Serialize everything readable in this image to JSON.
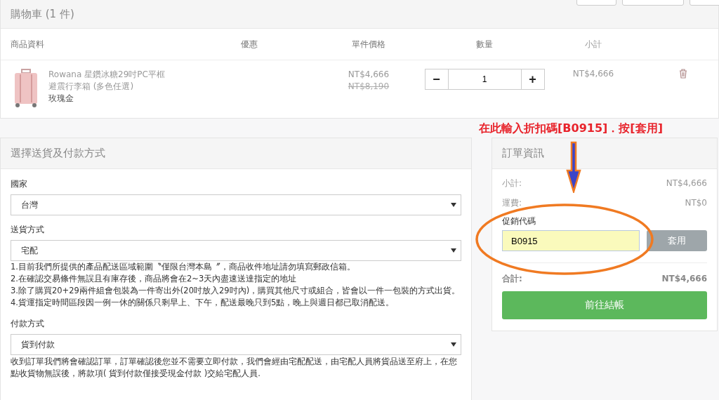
{
  "cart": {
    "title": "購物車 (1 件)",
    "columns": [
      "商品資料",
      "優惠",
      "單件價格",
      "數量",
      "小計"
    ],
    "items": [
      {
        "name": "Rowana 星鑽冰糖29吋PC平框避震行李箱 (多色任選)",
        "variant": "玫瑰金",
        "price": "NT$4,666",
        "original_price": "NT$8,190",
        "minus": "−",
        "quantity": "1",
        "plus": "+",
        "subtotal": "NT$4,666"
      }
    ]
  },
  "shipping": {
    "title": "選擇送貨及付款方式",
    "fields": [
      {
        "label": "國家",
        "value": "台灣"
      },
      {
        "label": "送貨方式",
        "value": "宅配"
      }
    ],
    "notes": [
      "1.目前我們所提供的產品配送區域範圍〝僅限台灣本島〞，商品收件地址請勿填寫郵政信箱。",
      "2.在確認交易條件無誤且有庫存後，商品將會在2~3天內盡速送達指定的地址",
      "3.除了購買20+29兩件組會包裝為一件寄出外(20吋放入29吋內)，購買其他尺寸或組合，皆會以一件一包裝的方式出貨。",
      "4.貨運指定時間區段因一例一休的關係只剩早上、下午，配送最晚只到5點，晚上與週日都已取消配送。"
    ],
    "payment": {
      "label": "付款方式",
      "value": "貨到付款",
      "note": "收到訂單我們將會確認訂單，訂單確認後您並不需要立即付款，我們會經由宅配配送，由宅配人員將貨品送至府上，在您點收貨物無誤後，將款項( 貨到付款僅接受現金付款 )交給宅配人員."
    }
  },
  "annotation": "在此輸入折扣碼[B0915]．按[套用]",
  "order": {
    "title": "訂單資訊",
    "rows": [
      {
        "label": "小計:",
        "value": "NT$4,666"
      },
      {
        "label": "運費:",
        "value": "NT$0"
      }
    ],
    "promo": {
      "label": "促銷代碼",
      "value": "B0915",
      "button": "套用"
    },
    "total": {
      "label": "合計:",
      "value": "NT$4,666"
    },
    "checkout": "前往結帳"
  }
}
